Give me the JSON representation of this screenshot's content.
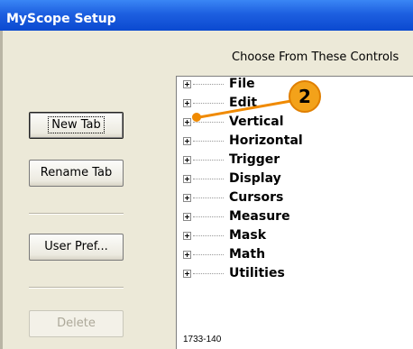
{
  "window": {
    "title": "MyScope Setup"
  },
  "buttons": {
    "new_tab": "New Tab",
    "rename_tab": "Rename Tab",
    "user_pref": "User Pref...",
    "delete": "Delete"
  },
  "controls": {
    "heading": "Choose From These Controls",
    "items": [
      "File",
      "Edit",
      "Vertical",
      "Horizontal",
      "Trigger",
      "Display",
      "Cursors",
      "Measure",
      "Mask",
      "Math",
      "Utilities"
    ]
  },
  "callout": {
    "number": "2",
    "color": "#f08a00"
  },
  "figure_number": "1733-140",
  "icons": {
    "expander": "plus-box-icon"
  }
}
